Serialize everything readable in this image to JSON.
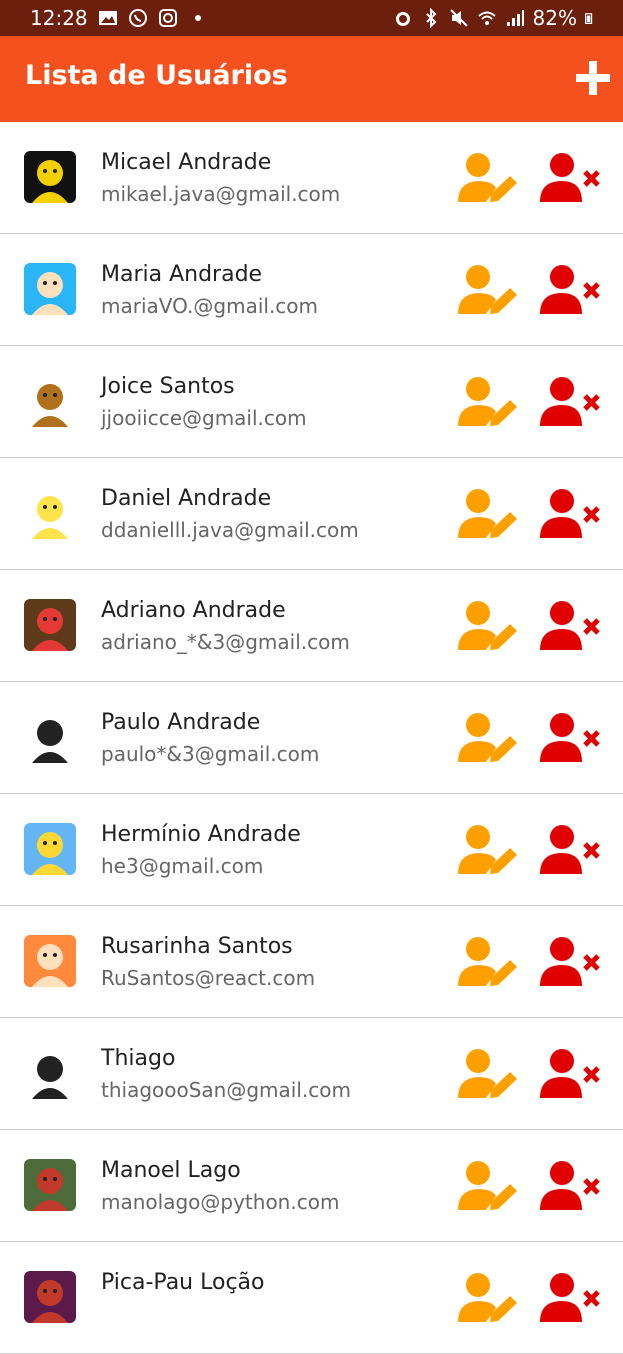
{
  "status_bar": {
    "time": "12:28",
    "battery": "82%"
  },
  "header": {
    "title": "Lista de Usuários",
    "add_icon": "plus-icon"
  },
  "colors": {
    "status_bar": "#6b1f0c",
    "header": "#f4511e",
    "edit_icon": "#ffa000",
    "delete_icon": "#e00000"
  },
  "users": [
    {
      "name": "Micael Andrade",
      "email": "mikael.java@gmail.com",
      "avatar_bg": "#111111",
      "avatar_fg": "#f5d000"
    },
    {
      "name": "Maria Andrade",
      "email": "mariaVO.@gmail.com",
      "avatar_bg": "#29b6f6",
      "avatar_fg": "#ffe0bd"
    },
    {
      "name": "Joice Santos",
      "email": "jjooiicce@gmail.com",
      "avatar_bg": "#ffffff",
      "avatar_fg": "#b0701c"
    },
    {
      "name": "Daniel Andrade",
      "email": "ddanielll.java@gmail.com",
      "avatar_bg": "#ffffff",
      "avatar_fg": "#ffe44d"
    },
    {
      "name": "Adriano Andrade",
      "email": "adriano_*&3@gmail.com",
      "avatar_bg": "#5d3a1a",
      "avatar_fg": "#e53935"
    },
    {
      "name": "Paulo Andrade",
      "email": "paulo*&3@gmail.com",
      "avatar_bg": "#ffffff",
      "avatar_fg": "#222222"
    },
    {
      "name": "Hermínio Andrade",
      "email": "he3@gmail.com",
      "avatar_bg": "#64b5f6",
      "avatar_fg": "#fdd835"
    },
    {
      "name": "Rusarinha Santos",
      "email": "RuSantos@react.com",
      "avatar_bg": "#ff8a3d",
      "avatar_fg": "#ffe0bd"
    },
    {
      "name": "Thiago",
      "email": "thiagoooSan@gmail.com",
      "avatar_bg": "#ffffff",
      "avatar_fg": "#222222"
    },
    {
      "name": "Manoel Lago",
      "email": "manolago@python.com",
      "avatar_bg": "#4e6b3a",
      "avatar_fg": "#c0392b"
    },
    {
      "name": "Pica-Pau Loção",
      "email": "",
      "avatar_bg": "#5c1a4a",
      "avatar_fg": "#c0392b"
    }
  ]
}
